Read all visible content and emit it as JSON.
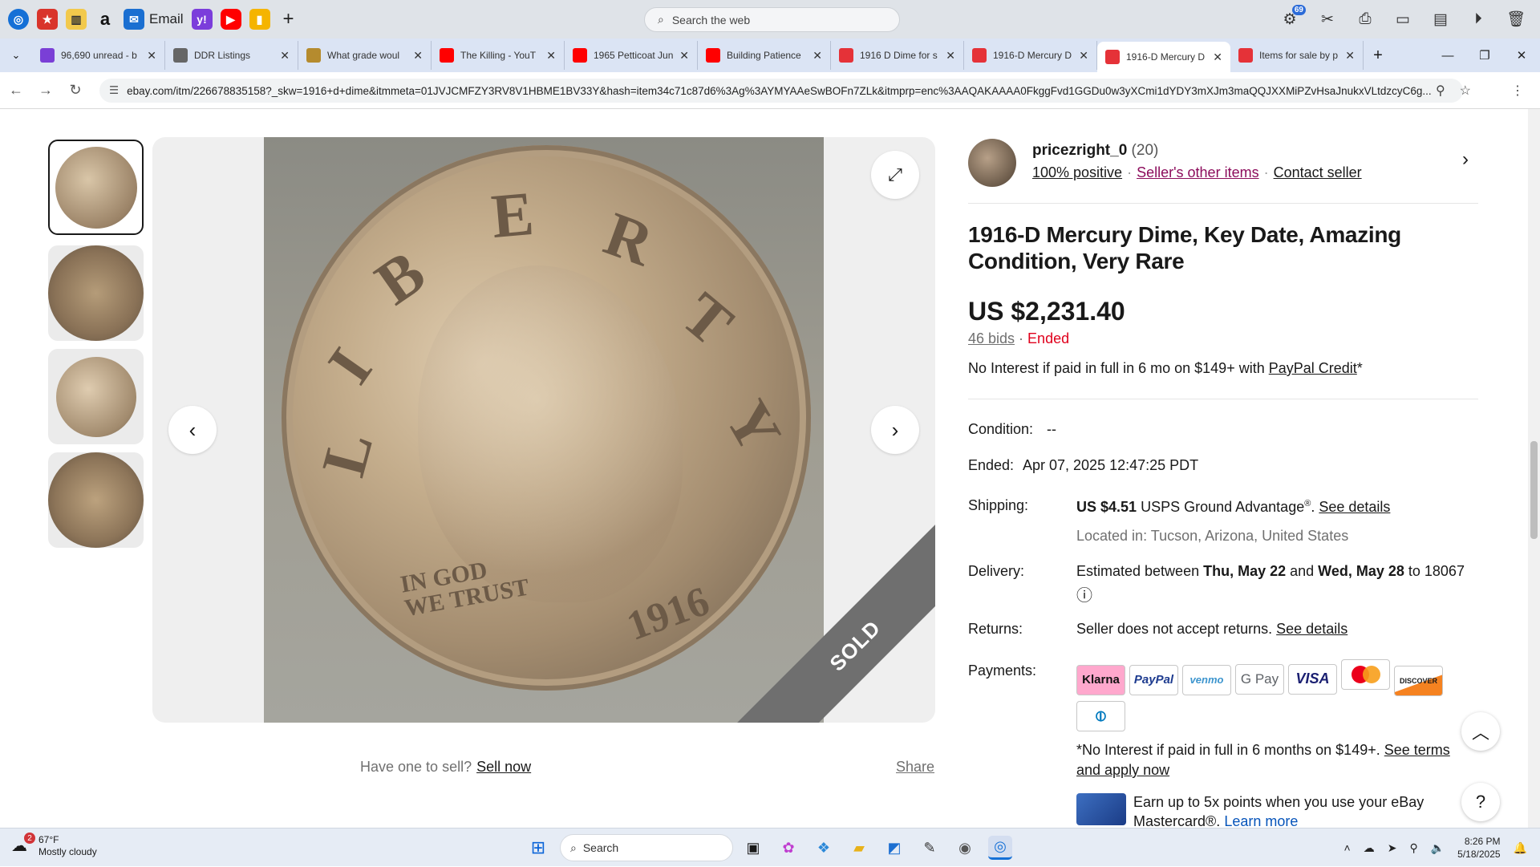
{
  "launcher": {
    "email_label": "Email",
    "search_placeholder": "Search the web",
    "notif_count": "69"
  },
  "tabs": [
    {
      "title": "96,690 unread - b",
      "icon": "mail-icon",
      "color": "#7a3fd6"
    },
    {
      "title": "DDR Listings",
      "icon": "globe-icon",
      "color": "#666666"
    },
    {
      "title": "What grade woul",
      "icon": "coin-icon",
      "color": "#b58b2e"
    },
    {
      "title": "The Killing - YouT",
      "icon": "youtube-icon",
      "color": "#ff0000"
    },
    {
      "title": "1965 Petticoat Jun",
      "icon": "youtube-icon",
      "color": "#ff0000"
    },
    {
      "title": "Building Patience",
      "icon": "youtube-icon",
      "color": "#ff0000"
    },
    {
      "title": "1916 D Dime for s",
      "icon": "ebay-icon",
      "color": "#e53238"
    },
    {
      "title": "1916-D Mercury D",
      "icon": "ebay-icon",
      "color": "#e53238"
    },
    {
      "title": "1916-D Mercury D",
      "icon": "ebay-icon",
      "color": "#e53238"
    },
    {
      "title": "Items for sale by p",
      "icon": "ebay-icon",
      "color": "#e53238"
    }
  ],
  "active_tab_index": 8,
  "address": {
    "url": "ebay.com/itm/226678835158?_skw=1916+d+dime&itmmeta=01JVJCMFZY3RV8V1HBME1BV33Y&hash=item34c71c87d6%3Ag%3AYMYAAeSwBOFn7ZLk&itmprp=enc%3AAQAKAAAA0FkggFvd1GGDu0w3yXCmi1dYDY3mXJm3maQQJXXMiPZvHsaJnukxVLtdzcyC6g..."
  },
  "gallery": {
    "sold_label": "SOLD",
    "coin_text": {
      "liberty_l": "L",
      "liberty_i": "I",
      "liberty_b": "B",
      "liberty_e": "E",
      "liberty_r": "R",
      "liberty_t": "T",
      "liberty_y": "Y",
      "motto": "IN GOD\nWE TRUST",
      "year": "1916"
    },
    "have_one": "Have one to sell?",
    "sell_now": "Sell now",
    "share": "Share"
  },
  "seller": {
    "name": "pricezright_0",
    "feedback_count": "(20)",
    "positive": "100% positive",
    "other_items": "Seller's other items",
    "contact": "Contact seller"
  },
  "listing": {
    "title": "1916-D Mercury Dime, Key Date, Amazing Condition, Very Rare",
    "price": "US $2,231.40",
    "bids": "46 bids",
    "status": "Ended",
    "no_interest_prefix": "No Interest if paid in full in 6 mo on $149+ with ",
    "paypal_credit": "PayPal Credit",
    "asterisk": "*",
    "condition_label": "Condition:",
    "condition_value": "--",
    "ended_label": "Ended:",
    "ended_value": "Apr 07, 2025 12:47:25 PDT",
    "shipping_label": "Shipping:",
    "shipping_price": "US $4.51",
    "shipping_service": "USPS Ground Advantage",
    "reg": "®",
    "see_details": "See details",
    "location": "Located in: Tucson, Arizona, United States",
    "delivery_label": "Delivery:",
    "delivery_prefix": "Estimated between ",
    "delivery_start": "Thu, May 22",
    "delivery_and": " and ",
    "delivery_end": "Wed, May 28",
    "delivery_to": " to 18067",
    "returns_label": "Returns:",
    "returns_value": "Seller does not accept returns.",
    "returns_details": "See details",
    "payments_label": "Payments:",
    "payment_methods": [
      "Klarna",
      "PayPal",
      "venmo",
      "G Pay",
      "VISA",
      "Mastercard",
      "DISCOVER",
      "Diners Club"
    ],
    "no_interest_long": "*No Interest if paid in full in 6 months on $149+.",
    "see_terms": "See terms and apply now",
    "promo_text": "Earn up to 5x points when you use your eBay Mastercard®.",
    "learn_more": "Learn more"
  },
  "taskbar": {
    "temp": "67°F",
    "weather": "Mostly cloudy",
    "weather_badge": "2",
    "search_placeholder": "Search",
    "time": "8:26 PM",
    "date": "5/18/2025"
  }
}
